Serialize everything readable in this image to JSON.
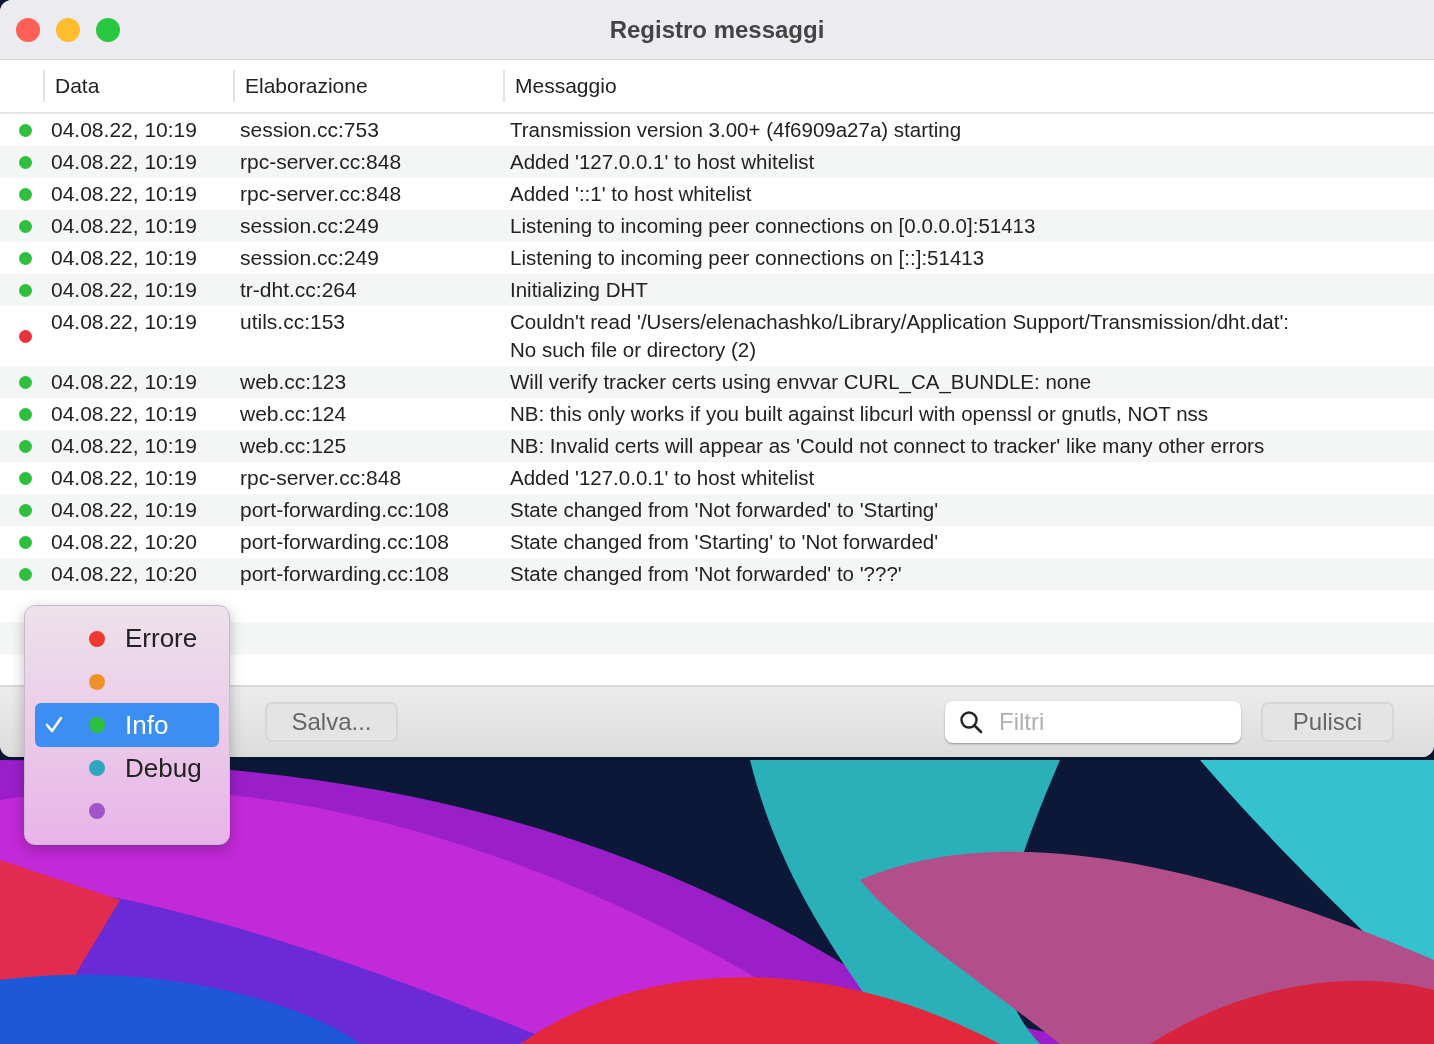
{
  "window": {
    "title": "Registro messaggi"
  },
  "table": {
    "columns": [
      "Data",
      "Elaborazione",
      "Messaggio"
    ],
    "rows": [
      {
        "color": "#2fbf3f",
        "date": "04.08.22, 10:19",
        "process": "session.cc:753",
        "message": "Transmission version 3.00+ (4f6909a27a) starting"
      },
      {
        "color": "#2fbf3f",
        "date": "04.08.22, 10:19",
        "process": "rpc-server.cc:848",
        "message": "Added '127.0.0.1' to host whitelist"
      },
      {
        "color": "#2fbf3f",
        "date": "04.08.22, 10:19",
        "process": "rpc-server.cc:848",
        "message": "Added '::1' to host whitelist"
      },
      {
        "color": "#2fbf3f",
        "date": "04.08.22, 10:19",
        "process": "session.cc:249",
        "message": "Listening to incoming peer connections on [0.0.0.0]:51413"
      },
      {
        "color": "#2fbf3f",
        "date": "04.08.22, 10:19",
        "process": "session.cc:249",
        "message": "Listening to incoming peer connections on [::]:51413"
      },
      {
        "color": "#2fbf3f",
        "date": "04.08.22, 10:19",
        "process": "tr-dht.cc:264",
        "message": "Initializing DHT"
      },
      {
        "color": "#e8343a",
        "date": "04.08.22, 10:19",
        "process": "utils.cc:153",
        "message": "Couldn't read '/Users/elenachashko/Library/Application Support/Transmission/dht.dat': No such file or directory (2)"
      },
      {
        "color": "#2fbf3f",
        "date": "04.08.22, 10:19",
        "process": "web.cc:123",
        "message": "Will verify tracker certs using envvar CURL_CA_BUNDLE: none"
      },
      {
        "color": "#2fbf3f",
        "date": "04.08.22, 10:19",
        "process": "web.cc:124",
        "message": "NB: this only works if you built against libcurl with openssl or gnutls, NOT nss"
      },
      {
        "color": "#2fbf3f",
        "date": "04.08.22, 10:19",
        "process": "web.cc:125",
        "message": "NB: Invalid certs will appear as 'Could not connect to tracker' like many other errors"
      },
      {
        "color": "#2fbf3f",
        "date": "04.08.22, 10:19",
        "process": "rpc-server.cc:848",
        "message": "Added '127.0.0.1' to host whitelist"
      },
      {
        "color": "#2fbf3f",
        "date": "04.08.22, 10:19",
        "process": "port-forwarding.cc:108",
        "message": "State changed from 'Not forwarded' to 'Starting'"
      },
      {
        "color": "#2fbf3f",
        "date": "04.08.22, 10:20",
        "process": "port-forwarding.cc:108",
        "message": "State changed from 'Starting' to 'Not forwarded'"
      },
      {
        "color": "#2fbf3f",
        "date": "04.08.22, 10:20",
        "process": "port-forwarding.cc:108",
        "message": "State changed from 'Not forwarded' to '???'"
      }
    ]
  },
  "toolbar": {
    "save": "Salva...",
    "search": {
      "placeholder": "Filtri"
    },
    "clear": "Pulisci"
  },
  "level_menu": [
    {
      "color": "#ee3a33",
      "label": "Errore",
      "selected": false
    },
    {
      "color": "#f0902a",
      "selected": false
    },
    {
      "color": "#2fbf3f",
      "label": "Info",
      "selected": true
    },
    {
      "color": "#30a6bf",
      "label": "Debug",
      "selected": false
    },
    {
      "color": "#a055cc",
      "selected": false
    }
  ]
}
